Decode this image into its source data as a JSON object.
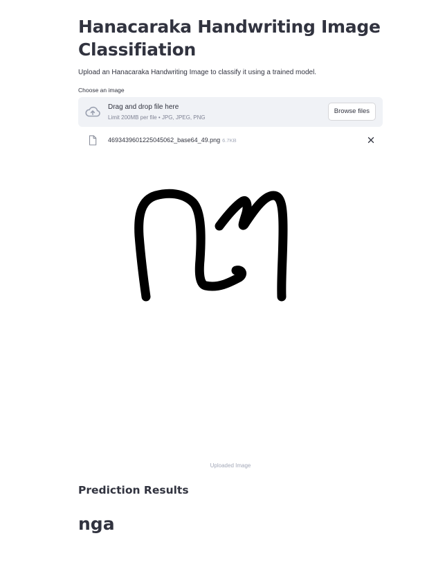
{
  "page": {
    "title": "Hanacaraka Handwriting Image Classifiation",
    "description": "Upload an Hanacaraka Handwriting Image to classify it using a trained model."
  },
  "uploader": {
    "label": "Choose an image",
    "drop_title": "Drag and drop file here",
    "drop_limit": "Limit 200MB per file • JPG, JPEG, PNG",
    "browse_label": "Browse files",
    "icon": "cloud-upload-icon"
  },
  "uploaded_file": {
    "name": "4693439601225045062_base64_49.png",
    "size": "6.7KB",
    "icon": "file-icon",
    "remove_icon": "close-icon"
  },
  "image": {
    "caption": "Uploaded Image"
  },
  "prediction": {
    "header": "Prediction Results",
    "label": "nga"
  },
  "colors": {
    "text": "#31333f",
    "muted": "#808495",
    "dropzone_bg": "#f0f2f6",
    "ink": "#000000"
  }
}
